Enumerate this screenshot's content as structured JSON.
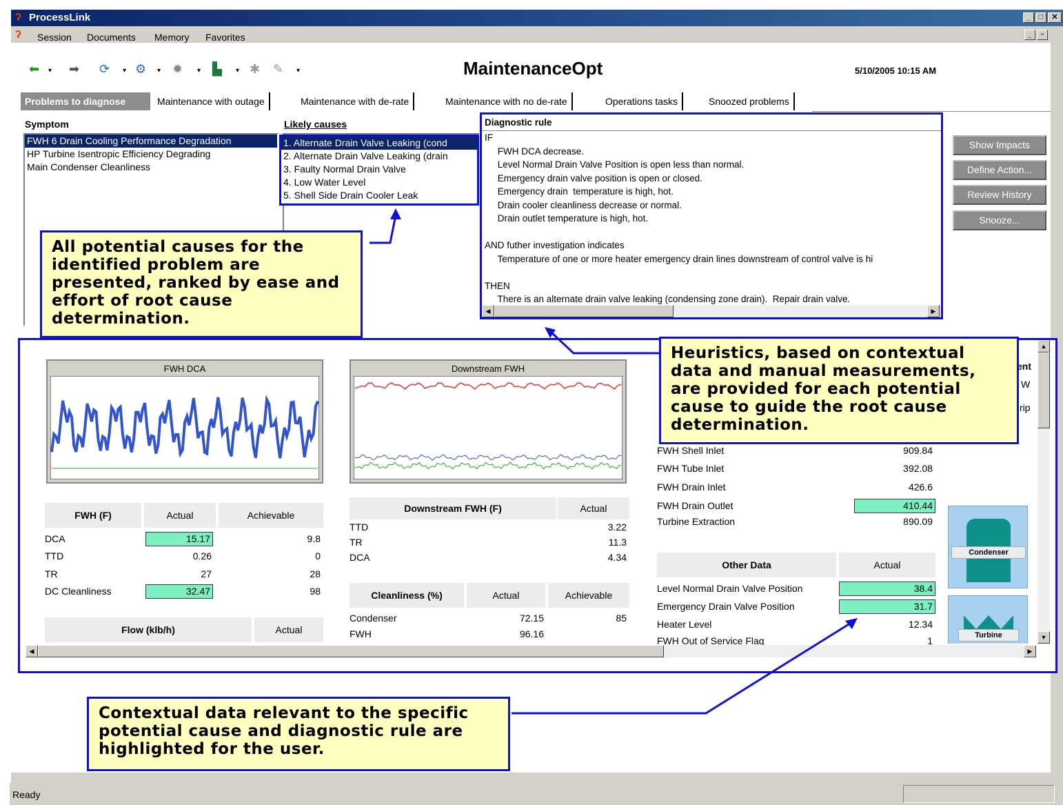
{
  "window": {
    "title": "ProcessLink",
    "min": "_",
    "max": "□",
    "close": "✕"
  },
  "menu": {
    "items": [
      "Session",
      "Documents",
      "Memory",
      "Favorites"
    ]
  },
  "header": {
    "app_title": "MaintenanceOpt",
    "datetime": "5/10/2005 10:15 AM"
  },
  "tabs": [
    {
      "label": "Problems to diagnose",
      "active": true
    },
    {
      "label": "Maintenance with outage"
    },
    {
      "label": "Maintenance with de-rate"
    },
    {
      "label": "Maintenance with no de-rate"
    },
    {
      "label": "Operations tasks"
    },
    {
      "label": "Snoozed problems"
    }
  ],
  "symptom": {
    "header": "Symptom",
    "items": [
      "FWH 6 Drain Cooling Performance Degradation",
      "HP Turbine Isentropic Efficiency Degrading",
      "Main Condenser Cleanliness"
    ]
  },
  "causes": {
    "header": "Likely causes",
    "items": [
      "1. Alternate Drain Valve Leaking (cond",
      "2. Alternate Drain Valve Leaking (drain",
      "3. Faulty Normal Drain Valve",
      "4. Low Water Level",
      "5. Shell Side Drain Cooler Leak"
    ]
  },
  "rule": {
    "header": "Diagnostic rule",
    "lines": [
      "IF",
      "     FWH DCA decrease.",
      "     Level Normal Drain Valve Position is open less than normal.",
      "     Emergency drain valve position is open or closed.",
      "     Emergency drain  temperature is high, hot.",
      "     Drain cooler cleanliness decrease or normal.",
      "     Drain outlet temperature is high, hot.",
      "",
      "AND futher investigation indicates",
      "     Temperature of one or more heater emergency drain lines downstream of control valve is hi",
      "",
      "THEN",
      "     There is an alternate drain valve leaking (condensing zone drain).  Repair drain valve."
    ]
  },
  "side_buttons": [
    "Show Impacts",
    "Define Action...",
    "Review History",
    "Snooze..."
  ],
  "callouts": {
    "causes": "All potential causes for the identified problem are presented, ranked by ease and effort of root cause determination.",
    "heuristics": "Heuristics, based on contextual data and manual measurements, are provided for each potential cause to guide the root cause determination.",
    "contextual": "Contextual data relevant to the specific potential cause and diagnostic rule are highlighted for the user."
  },
  "chart_data": [
    {
      "type": "line",
      "title": "FWH DCA",
      "series": [
        {
          "color": "#3355cc"
        },
        {
          "color": "#22aa22"
        }
      ]
    },
    {
      "type": "line",
      "title": "Downstream FWH",
      "series": [
        {
          "color": "#ee3333"
        },
        {
          "color": "#3355cc"
        },
        {
          "color": "#22aa22"
        }
      ]
    }
  ],
  "fwh_table": {
    "headers": [
      "FWH (F)",
      "Actual",
      "Achievable"
    ],
    "rows": [
      {
        "label": "DCA",
        "actual": "15.17",
        "achievable": "9.8",
        "highlight": true
      },
      {
        "label": "TTD",
        "actual": "0.26",
        "achievable": "0"
      },
      {
        "label": "TR",
        "actual": "27",
        "achievable": "28"
      },
      {
        "label": "DC Cleanliness",
        "actual": "32.47",
        "achievable": "98",
        "highlight": true
      }
    ]
  },
  "flow_table": {
    "headers": [
      "Flow (klb/h)",
      "Actual"
    ]
  },
  "downstream_table": {
    "headers": [
      "Downstream FWH (F)",
      "Actual"
    ],
    "rows": [
      {
        "label": "TTD",
        "actual": "3.22"
      },
      {
        "label": "TR",
        "actual": "11.3"
      },
      {
        "label": "DCA",
        "actual": "4.34"
      }
    ]
  },
  "cleanliness_table": {
    "headers": [
      "Cleanliness (%)",
      "Actual",
      "Achievable"
    ],
    "rows": [
      {
        "label": "Condenser",
        "actual": "72.15",
        "achievable": "85"
      },
      {
        "label": "FWH",
        "actual": "96.16",
        "achievable": ""
      }
    ]
  },
  "temps": {
    "partial": [
      "ent",
      "W",
      "rip"
    ],
    "rows": [
      {
        "label": "FWH Shell Inlet",
        "actual": "909.84"
      },
      {
        "label": "FWH Tube Inlet",
        "actual": "392.08"
      },
      {
        "label": "FWH Drain Inlet",
        "actual": "426.6"
      },
      {
        "label": "FWH Drain Outlet",
        "actual": "410.44",
        "highlight": true
      },
      {
        "label": "Turbine Extraction",
        "actual": "890.09"
      }
    ]
  },
  "other_table": {
    "headers": [
      "Other Data",
      "Actual"
    ],
    "rows": [
      {
        "label": "Level Normal Drain Valve Position",
        "actual": "38.4",
        "highlight": true
      },
      {
        "label": "Emergency Drain Valve Position",
        "actual": "31.7",
        "highlight": true
      },
      {
        "label": "Heater Level",
        "actual": "12.34"
      },
      {
        "label": "FWH Out of Service Flag",
        "actual": "1"
      }
    ]
  },
  "equipment": {
    "condenser": "Condenser",
    "turbine": "Turbine"
  },
  "status": {
    "text": "Ready"
  }
}
